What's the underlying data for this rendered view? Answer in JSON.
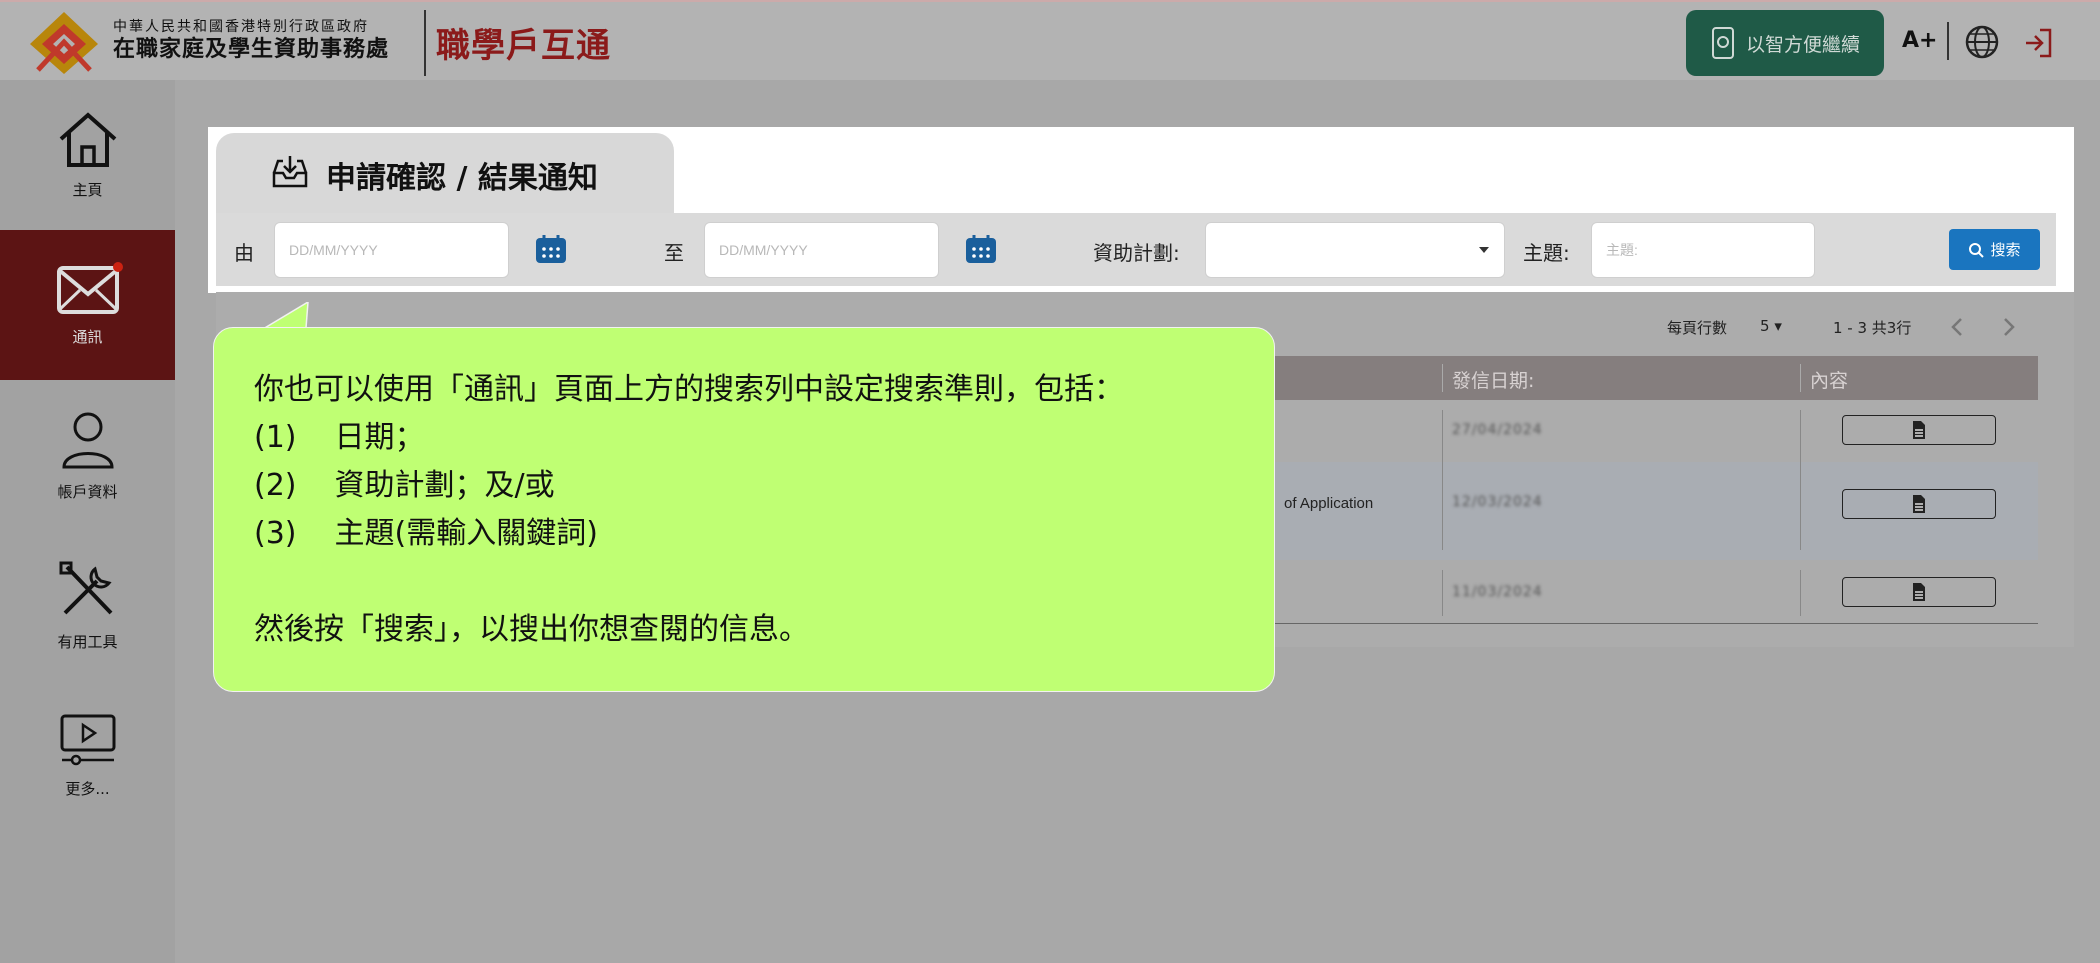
{
  "header": {
    "org_line1": "中華人民共和國香港特別行政區政府",
    "org_line2": "在職家庭及學生資助事務處",
    "brand": "職學戶互通",
    "continue_mobile": "以智方便繼續",
    "font_size_btn": "A+",
    "colors": {
      "brand": "#8b1a1a",
      "mobile_btn": "#1f5a47"
    }
  },
  "sidebar": {
    "items": [
      {
        "label": "主頁",
        "icon": "home-icon"
      },
      {
        "label": "通訊",
        "icon": "envelope-icon",
        "active": true
      },
      {
        "label": "帳戶資料",
        "icon": "user-icon"
      },
      {
        "label": "有用工具",
        "icon": "tools-icon"
      },
      {
        "label": "更多...",
        "icon": "video-icon"
      }
    ]
  },
  "page": {
    "tab_title": "申請確認 / 結果通知",
    "filter": {
      "from_label": "由",
      "to_label": "至",
      "date_placeholder": "DD/MM/YYYY",
      "scheme_label": "資助計劃:",
      "subject_label": "主題:",
      "subject_placeholder": "主題:",
      "search_btn": "搜索"
    },
    "pagination": {
      "rows_label": "每頁行數",
      "rows_value": "5",
      "range": "1 - 3  共3行"
    },
    "table": {
      "headers": [
        "發信日期:",
        "內容"
      ],
      "rows": [
        {
          "subject": "",
          "date": "27/04/2024"
        },
        {
          "subject": "of Application",
          "date": "12/03/2024"
        },
        {
          "subject": "",
          "date": "11/03/2024"
        }
      ]
    }
  },
  "callout": {
    "line1": "你也可以使用「通訊」頁面上方的搜索列中設定搜索準則，包括：",
    "items": [
      {
        "num": "(1)",
        "text": "日期；"
      },
      {
        "num": "(2)",
        "text": "資助計劃；及/或"
      },
      {
        "num": "(3)",
        "text": "主題(需輸入關鍵詞)"
      }
    ],
    "line_end": "然後按「搜索」，以搜出你想查閱的信息。",
    "color": "#bfff73"
  }
}
